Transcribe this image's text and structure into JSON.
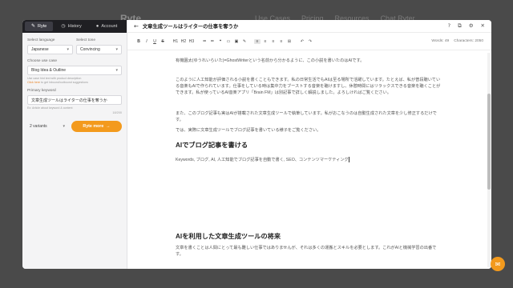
{
  "backdrop": {
    "logo": "Ryte",
    "nav": [
      "Use Cases",
      "Pricing",
      "Resources",
      "Chat Ryter"
    ]
  },
  "sidebar": {
    "tabs": [
      {
        "label": "Ryte",
        "icon": "edit-icon"
      },
      {
        "label": "History",
        "icon": "clock-icon"
      },
      {
        "label": "Account",
        "icon": "user-icon"
      }
    ],
    "language_label": "Select language",
    "language_value": "Japanese",
    "tone_label": "Select tone",
    "tone_value": "Convincing",
    "use_case_label": "Choose use case",
    "use_case_value": "Blog Idea & Outline",
    "use_case_hint_1": "Use case hint text with product description",
    "use_case_hint_link": "Click here",
    "use_case_hint_2": "to get inbound/outbound suggestions",
    "keyword_label": "Primary keyword",
    "keyword_value": "文章生成ツールはライターの仕事を奪うか",
    "keyword_hint": "Ex: Article about keyword & content",
    "keyword_counter": "18/200",
    "variants_value": "2 variants",
    "write_button": "Ryte more"
  },
  "editor": {
    "title": "文章生成ツールはライターの仕事を奪うか",
    "toolbar": [
      "B",
      "I",
      "U",
      "S",
      "H1",
      "H2",
      "H3",
      "≔",
      "≕",
      "❝",
      "▭",
      "▣",
      "✎",
      "≡",
      "≡",
      "≡",
      "≡",
      "⊞",
      "↶",
      "↷"
    ],
    "words": "Words: 49",
    "characters": "Characters: 2050",
    "para1": "有機園太(ゆうれいらいた)=GhostWriterという名前から分かるように、この小説を書いたのはAIです。",
    "para2": "このように人工知能が評価される小説を書くこともできます。私の日常生活でもAIは至る場所で活躍しています。たとえば、私が普段聴いている音楽もAIで作られています。仕事をしている時は集中力をブーストする音楽を聴けますし、休憩時間にはリラックスできる音楽を聴くことができます。私が使っているAI音楽アプリ「Brain FM」は別記事で詳しく解説しました。よろしければご覧ください。",
    "para3": "また、このブログ記事も実はAIが搭載された文章生成ツールで執筆しています。私がおこなうのは自動生成された文章を少し修正するだけです。",
    "para4": "では、実際に文章生成ツールでブログ記事を書いている様子をご覧ください。",
    "heading1": "AIでブログ記事を書ける",
    "keywords_line": "Keywords, ブログ, AI, 人工知能でブログ記事を自動で書く, SEO、コンテンツマーケティング",
    "heading2": "AIを利用した文章生成ツールの将来",
    "para5": "文章を書くことは人間にとって最も難しい仕事ではありませんが、それは多くの運搬とスキルを必要とします。これがAIと機械学習の出番です。"
  },
  "colors": {
    "accent": "#f39a1d",
    "sidebar_header": "#1f1f23"
  }
}
